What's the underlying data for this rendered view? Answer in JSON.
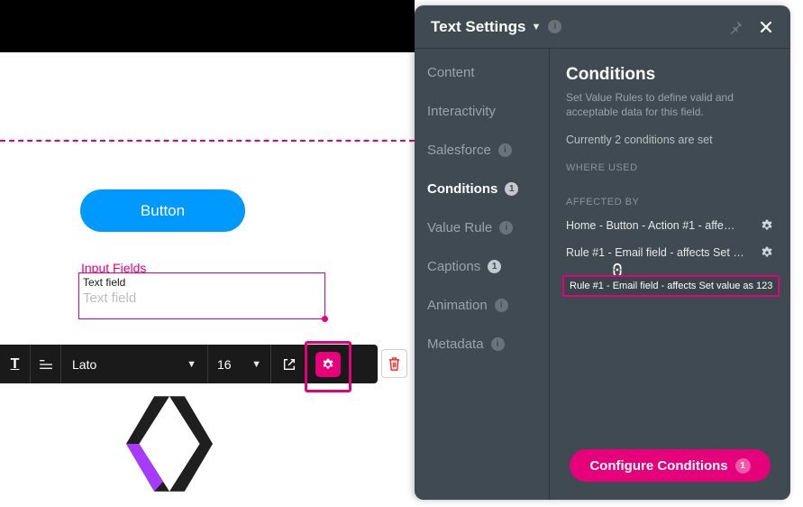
{
  "canvas": {
    "button_label": "Button",
    "fields_label": "Input Fields",
    "text_field_label": "Text field",
    "text_field_placeholder": "Text field"
  },
  "toolbar": {
    "font_family": "Lato",
    "font_size": "16"
  },
  "panel": {
    "title": "Text Settings",
    "tabs": [
      {
        "label": "Content",
        "badge": null
      },
      {
        "label": "Interactivity",
        "badge": null
      },
      {
        "label": "Salesforce",
        "badge": "i"
      },
      {
        "label": "Conditions",
        "badge": "1",
        "active": true
      },
      {
        "label": "Value Rule",
        "badge": "i"
      },
      {
        "label": "Captions",
        "badge": "1"
      },
      {
        "label": "Animation",
        "badge": "i"
      },
      {
        "label": "Metadata",
        "badge": "i"
      }
    ],
    "conditions": {
      "heading": "Conditions",
      "description": "Set Value Rules to define valid and acceptable data for this field.",
      "summary": "Currently 2 conditions are set",
      "where_used_label": "WHERE USED",
      "affected_by_label": "AFFECTED BY",
      "rules": [
        {
          "text": "Home - Button - Action #1 - affe…"
        },
        {
          "text": "Rule #1 - Email field - affects Set …"
        }
      ],
      "tooltip": "Rule #1 - Email field - affects Set value as 123",
      "configure_label": "Configure Conditions",
      "configure_count": "1"
    }
  }
}
